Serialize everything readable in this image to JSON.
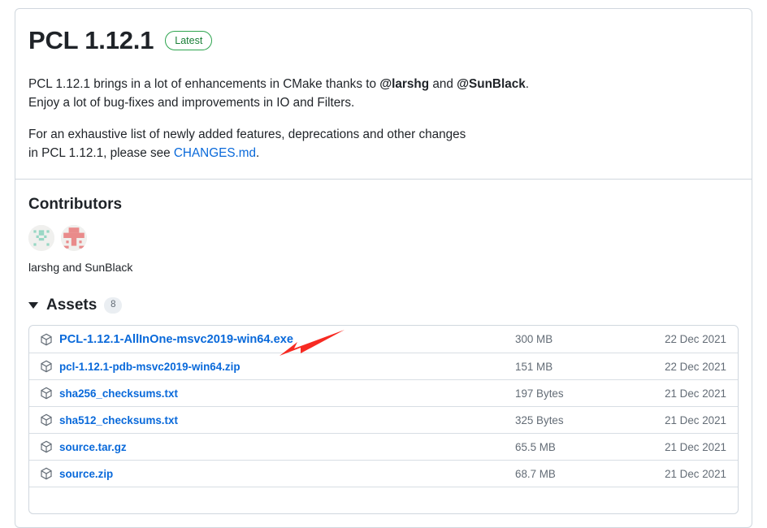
{
  "release": {
    "title": "PCL 1.12.1",
    "latest_badge": "Latest",
    "description": {
      "p1_before_mention1": "PCL 1.12.1 brings in a lot of enhancements in CMake thanks to ",
      "mention1": "@larshg",
      "p1_between_mentions": " and ",
      "mention2": "@SunBlack",
      "p1_after_mention2": ".",
      "p1_line2": "Enjoy a lot of bug-fixes and improvements in IO and Filters.",
      "p2_line1": "For an exhaustive list of newly added features, deprecations and other changes",
      "p2_line2_before_link": "in PCL 1.12.1, please see ",
      "p2_link": "CHANGES.md",
      "p2_after_link": "."
    }
  },
  "contributors": {
    "heading": "Contributors",
    "names": "larshg and SunBlack",
    "avatars": [
      {
        "name": "larshg",
        "color": "#97d7c4"
      },
      {
        "name": "SunBlack",
        "color": "#e98b8b"
      }
    ]
  },
  "assets": {
    "heading": "Assets",
    "count": "8",
    "expanded": true,
    "columns": [
      "name",
      "size",
      "date"
    ],
    "rows": [
      {
        "name": "PCL-1.12.1-AllInOne-msvc2019-win64.exe",
        "size": "300 MB",
        "date": "22 Dec 2021",
        "icon": "package-icon",
        "featured": true
      },
      {
        "name": "pcl-1.12.1-pdb-msvc2019-win64.zip",
        "size": "151 MB",
        "date": "22 Dec 2021",
        "icon": "package-icon",
        "featured": false
      },
      {
        "name": "sha256_checksums.txt",
        "size": "197 Bytes",
        "date": "21 Dec 2021",
        "icon": "package-icon",
        "featured": false
      },
      {
        "name": "sha512_checksums.txt",
        "size": "325 Bytes",
        "date": "21 Dec 2021",
        "icon": "package-icon",
        "featured": false
      },
      {
        "name": "source.tar.gz",
        "size": "65.5 MB",
        "date": "21 Dec 2021",
        "icon": "package-icon",
        "featured": false
      },
      {
        "name": "source.zip",
        "size": "68.7 MB",
        "date": "21 Dec 2021",
        "icon": "package-icon",
        "featured": false
      }
    ]
  },
  "annotation": {
    "type": "arrow",
    "color": "#f72a22",
    "points_to": "PCL-1.12.1-AllInOne-msvc2019-win64.exe"
  },
  "colors": {
    "link": "#0969da",
    "badge_green": "#2da44e",
    "border": "#d0d7de",
    "muted_text": "#636c76",
    "annotation_red": "#f72a22"
  }
}
